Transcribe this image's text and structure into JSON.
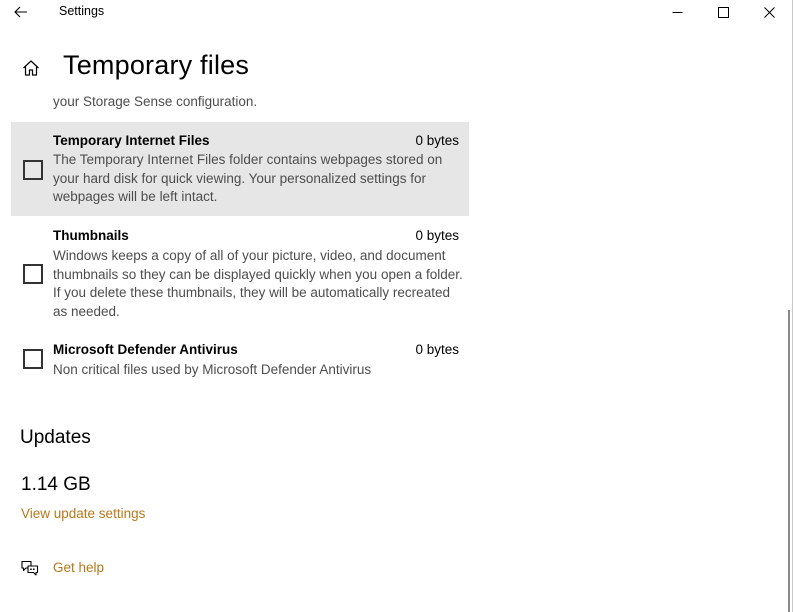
{
  "window": {
    "title": "Settings",
    "controls": {
      "minimize": "minimize-icon",
      "maximize": "maximize-icon",
      "close": "close-icon"
    }
  },
  "header": {
    "page_title": "Temporary files",
    "home_icon": "home-icon",
    "back_icon": "back-arrow-icon"
  },
  "partial_item": {
    "desc_tail": "your Storage Sense configuration."
  },
  "items": [
    {
      "name": "Temporary Internet Files",
      "size": "0 bytes",
      "description": "The Temporary Internet Files folder contains webpages stored on your hard disk for quick viewing. Your personalized settings for webpages will be left intact.",
      "checked": false
    },
    {
      "name": "Thumbnails",
      "size": "0 bytes",
      "description": "Windows keeps a copy of all of your picture, video, and document thumbnails so they can be displayed quickly when you open a folder. If you delete these thumbnails, they will be automatically recreated as needed.",
      "checked": false
    },
    {
      "name": "Microsoft Defender Antivirus",
      "size": "0 bytes",
      "description": "Non critical files used by Microsoft Defender Antivirus",
      "checked": false
    }
  ],
  "updates": {
    "section_title": "Updates",
    "size": "1.14 GB",
    "link": "View update settings"
  },
  "help": {
    "label": "Get help",
    "icon": "chat-help-icon"
  },
  "colors": {
    "accent_link": "#b8781a",
    "hover_bg": "#e6e6e6",
    "desc_text": "#4d4d4d"
  }
}
